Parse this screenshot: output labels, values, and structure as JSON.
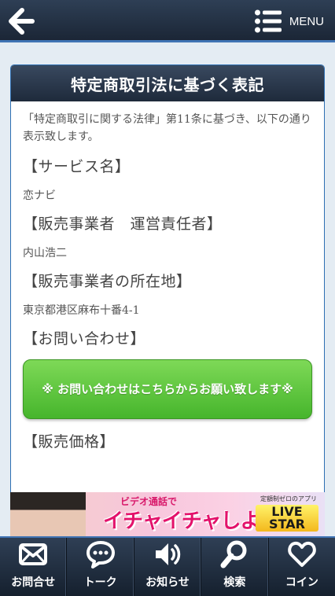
{
  "header": {
    "menu_label": "MENU"
  },
  "page": {
    "title": "特定商取引法に基づく表記",
    "intro": "「特定商取引に関する法律」第11条に基づき、以下の通り表示致します。",
    "sections": [
      {
        "title": "【サービス名】",
        "value": "恋ナビ"
      },
      {
        "title": "【販売事業者　運営責任者】",
        "value": "内山浩二"
      },
      {
        "title": "【販売事業者の所在地】",
        "value": "東京都港区麻布十番4-1"
      },
      {
        "title": "【お問い合わせ】"
      },
      {
        "title": "【販売価格】"
      }
    ],
    "contact_button": "※ お問い合わせはこちらからお願い致します※"
  },
  "banner": {
    "small_text": "ビデオ通話で",
    "big_text": "イチャイチャしよっ♥",
    "tag": "定額制ゼロのアプリ",
    "logo": "LIVE STAR"
  },
  "bottom_nav": [
    {
      "label": "お問合せ",
      "icon": "envelope-icon"
    },
    {
      "label": "トーク",
      "icon": "chat-bubble-icon"
    },
    {
      "label": "お知らせ",
      "icon": "speaker-icon"
    },
    {
      "label": "検索",
      "icon": "search-icon"
    },
    {
      "label": "コイン",
      "icon": "heart-icon"
    }
  ],
  "colors": {
    "header_bg": "#1e2a3b",
    "accent_border": "#3f74b4",
    "button_green": "#46b52c",
    "page_bg": "#e4ecf3"
  }
}
